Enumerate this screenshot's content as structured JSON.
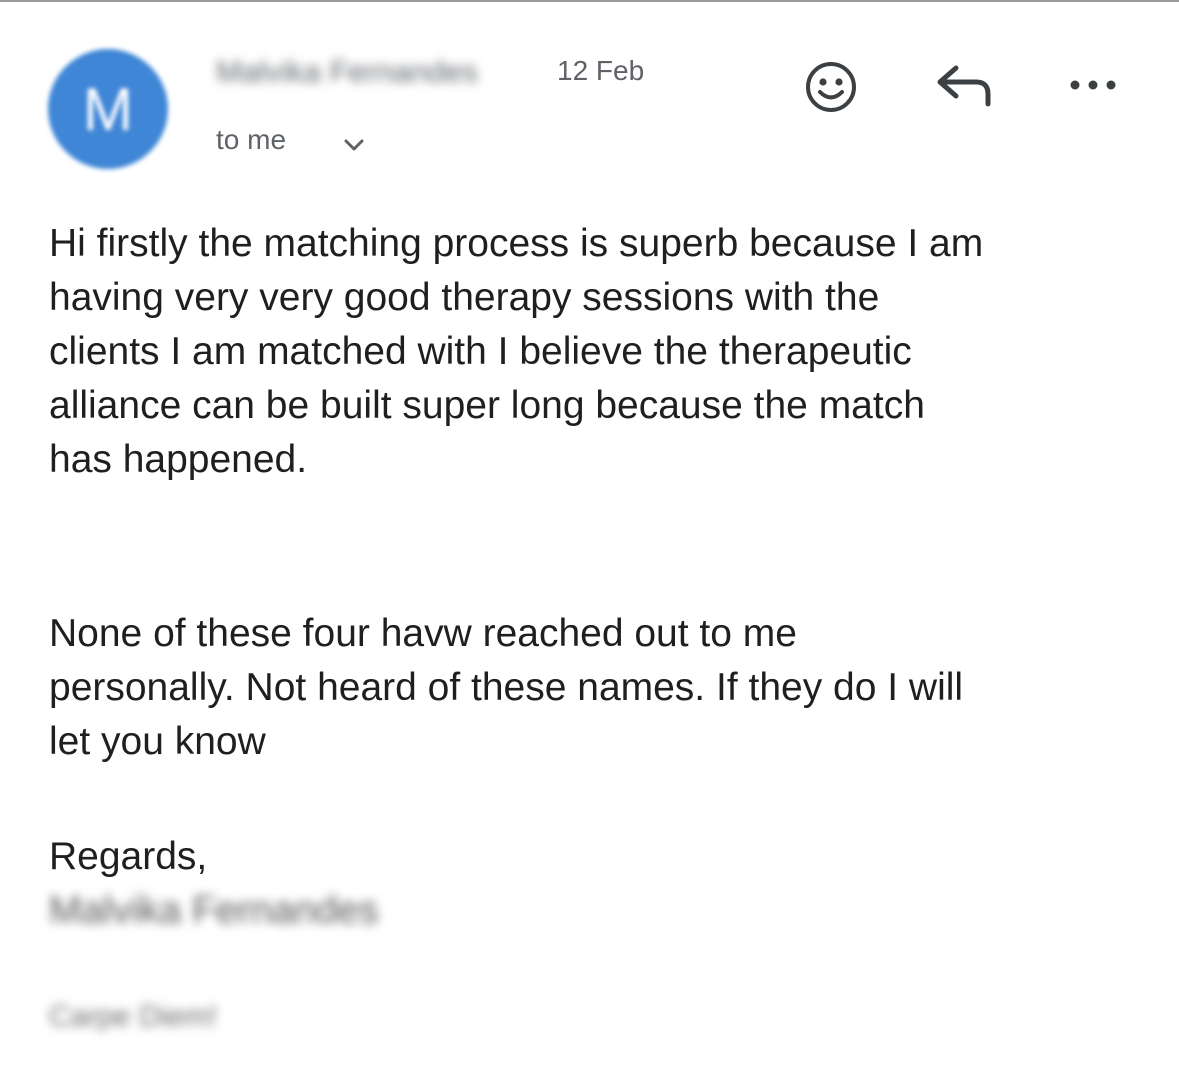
{
  "email": {
    "avatar_initial": "M",
    "sender_name": "Malvika Fernandes",
    "date": "12 Feb",
    "recipient_label": "to me",
    "body_paragraph_1": [
      "Hi firstly the matching process is superb because I am",
      "having very very good therapy sessions with the",
      "clients I am matched with I believe the therapeutic",
      "alliance can be built super long because the match",
      "has happened."
    ],
    "body_paragraph_2": [
      "None of these four havw reached out to me",
      "personally. Not heard of these names. If they do I will",
      "let you know"
    ],
    "closing": "Regards,",
    "signature_name": "Malvika Fernandes",
    "signature_tagline": "Carpe Diem!"
  },
  "icons": {
    "avatar_color": "#3f86d6",
    "emoji": "smiley-face-icon",
    "reply": "reply-arrow-icon",
    "more": "more-options-icon",
    "expand": "chevron-down-icon"
  }
}
